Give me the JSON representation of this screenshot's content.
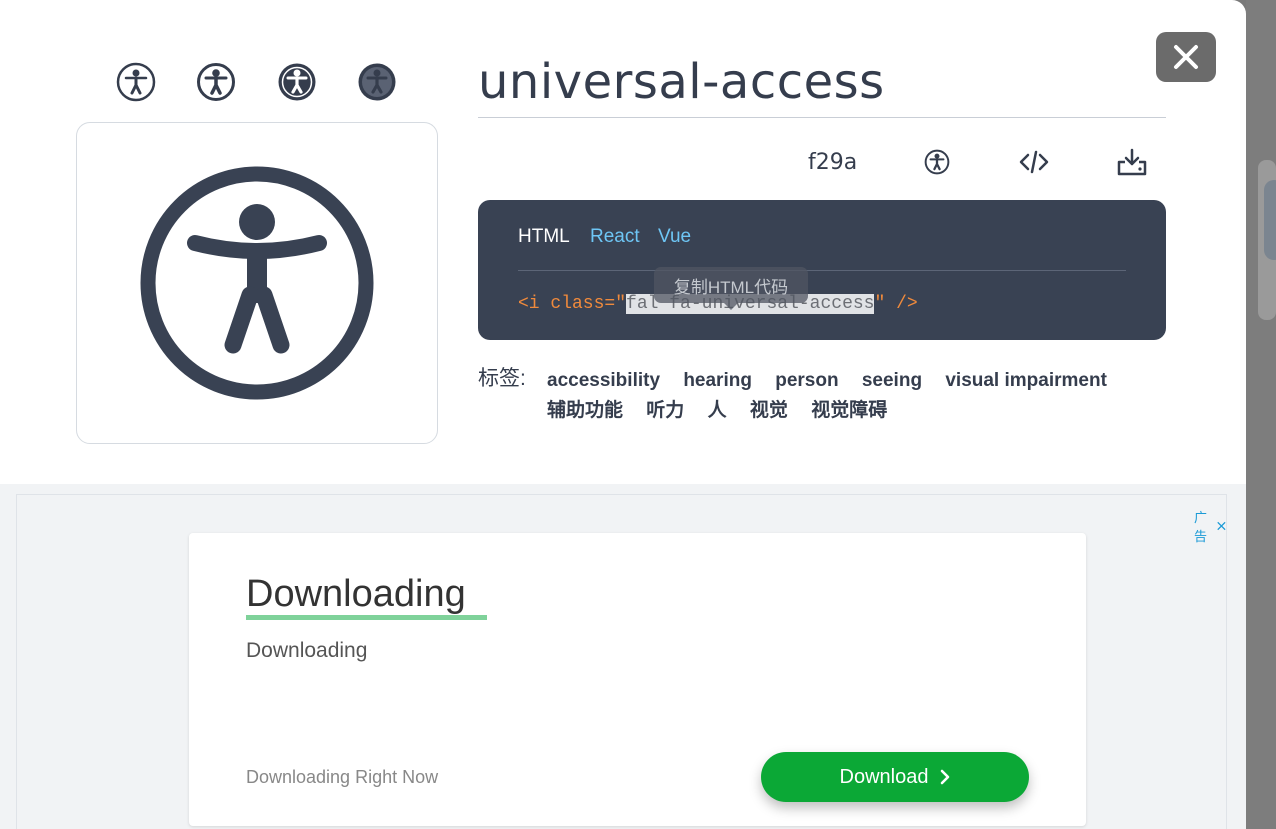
{
  "icon": {
    "name": "universal-access",
    "unicode": "f29a",
    "variants": [
      "light",
      "regular",
      "solid",
      "duotone"
    ]
  },
  "toolbar": {
    "icons": [
      "universal-access-icon",
      "code-icon",
      "download-icon"
    ]
  },
  "code": {
    "tabs": [
      {
        "label": "HTML",
        "active": true
      },
      {
        "label": "React",
        "active": false
      },
      {
        "label": "Vue",
        "active": false
      }
    ],
    "prefix": "<i class=\"",
    "selected": "fal fa-universal-access",
    "suffix": "\" />",
    "tooltip": "复制HTML代码"
  },
  "tags": {
    "label": "标签:",
    "items": [
      "accessibility",
      "hearing",
      "person",
      "seeing",
      "visual impairment",
      "辅助功能",
      "听力",
      "人",
      "视觉",
      "视觉障碍"
    ]
  },
  "ad": {
    "label": "广告",
    "title": "Downloading",
    "subtitle": "Downloading",
    "footer": "Downloading Right Now",
    "button": "Download"
  },
  "colors": {
    "dark": "#394253",
    "accent_tab": "#6ec6f5",
    "code_orange": "#f08a3c",
    "ad_green": "#0ba836"
  }
}
